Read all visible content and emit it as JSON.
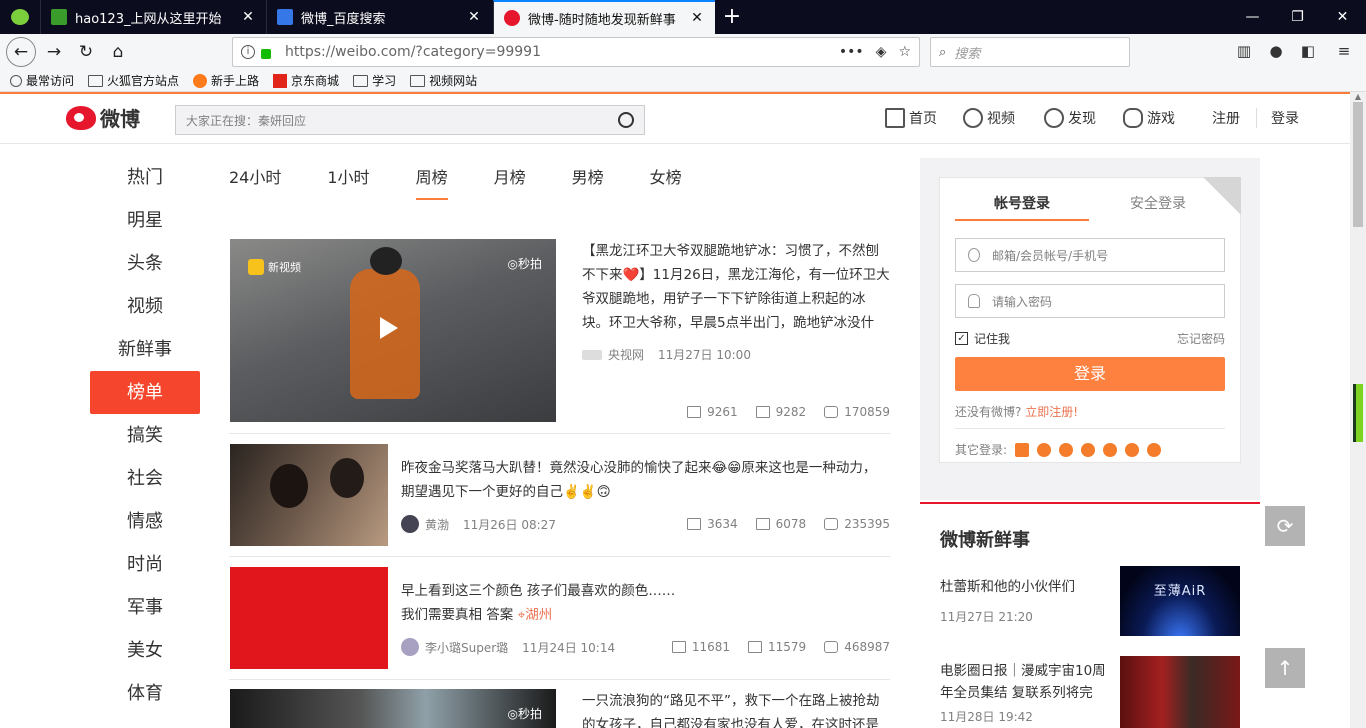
{
  "browser": {
    "tabs": [
      {
        "title": "hao123_上网从这里开始",
        "color": "#3a9c2a"
      },
      {
        "title": "微博_百度搜索",
        "color": "#3677e8"
      },
      {
        "title": "微博-随时随地发现新鲜事",
        "color": "#e6162d"
      }
    ],
    "url": "https://weibo.com/?category=99991",
    "search_placeholder": "搜索",
    "bookmarks": [
      "最常访问",
      "火狐官方站点",
      "新手上路",
      "京东商城",
      "学习",
      "视频网站"
    ]
  },
  "weibo": {
    "logo_text": "微博",
    "search_placeholder": "大家正在搜：秦妍回应",
    "nav": {
      "home": "首页",
      "video": "视频",
      "discover": "发现",
      "game": "游戏",
      "register": "注册",
      "login": "登录"
    },
    "left_nav": [
      "热门",
      "明星",
      "头条",
      "视频",
      "新鲜事",
      "榜单",
      "搞笑",
      "社会",
      "情感",
      "时尚",
      "军事",
      "美女",
      "体育"
    ],
    "left_nav_active": "榜单",
    "rank_tabs": [
      "24小时",
      "1小时",
      "周榜",
      "月榜",
      "男榜",
      "女榜"
    ],
    "rank_tab_active": "周榜",
    "feed": [
      {
        "text": "【黑龙江环卫大爷双腿跪地铲冰：习惯了，不然刨不下来❤️】11月26日，黑龙江海伦，有一位环卫大爷双腿跪地，用铲子一下下铲除街道上积起的冰块。环卫大爷称，早晨5点半出门，跪地铲冰没什",
        "author": "央视网",
        "time": "11月27日 10:00",
        "video_badge": "秒拍",
        "video_tag": "新视频",
        "reposts": "9261",
        "comments": "9282",
        "likes": "170859"
      },
      {
        "text": "昨夜金马奖落马大趴替！竟然没心没肺的愉快了起来😂😁原来这也是一种动力，期望遇见下一个更好的自己✌️✌️🙃",
        "author": "黄渤",
        "time": "11月26日 08:27",
        "reposts": "3634",
        "comments": "6078",
        "likes": "235395"
      },
      {
        "text": "早上看到这三个颜色 孩子们最喜欢的颜色……",
        "text2": "我们需要真相 答案",
        "location": "湖州",
        "author": "李小璐Super璐",
        "time": "11月24日 10:14",
        "reposts": "11681",
        "comments": "11579",
        "likes": "468987"
      },
      {
        "text": "一只流浪狗的“路见不平”，救下一个在路上被抢劫的女孩子，自己都没有家也没有人爱，在这时还是",
        "video_badge": "秒拍"
      }
    ],
    "login": {
      "tab_account": "帐号登录",
      "tab_secure": "安全登录",
      "user_placeholder": "邮箱/会员帐号/手机号",
      "pass_placeholder": "请输入密码",
      "remember": "记住我",
      "forgot": "忘记密码",
      "button": "登录",
      "no_account": "还没有微博?",
      "register_link": "立即注册!",
      "other_login": "其它登录:"
    },
    "fresh": {
      "title": "微博新鲜事",
      "items": [
        {
          "title": "杜蕾斯和他的小伙伴们",
          "time": "11月27日 21:20",
          "img_text": "至薄AiR"
        },
        {
          "title": "电影圈日报｜漫威宇宙10周年全员集结 复联系列将完",
          "time": "11月28日 19:42"
        }
      ]
    }
  }
}
